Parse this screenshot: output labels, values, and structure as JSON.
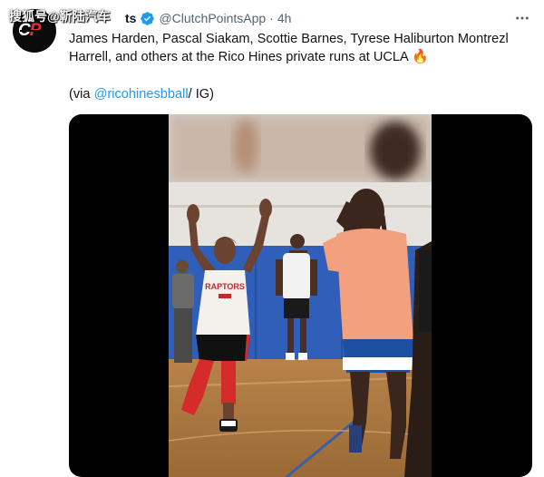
{
  "watermark": {
    "text": "搜狐号@靳陆汽车"
  },
  "account": {
    "display_name_tail": "ts",
    "handle": "@ClutchPointsApp",
    "separator": "·",
    "timestamp": "4h",
    "avatar_logo_c": "C",
    "avatar_logo_p": "P"
  },
  "tweet": {
    "text": "James Harden, Pascal Siakam, Scottie Barnes, Tyrese Haliburton Montrezl Harrell, and others at the Rico Hines private runs at UCLA",
    "emoji": "🔥",
    "via_prefix": "(via ",
    "via_mention": "@ricohinesbball",
    "via_suffix": "/ IG)"
  },
  "media": {
    "type": "video",
    "jersey_text": "RAPTORS"
  },
  "colors": {
    "accent": "#1d9bf0",
    "secondary_text": "#536471",
    "brand_red": "#e0312d",
    "court_wall": "#2f5fb8"
  }
}
